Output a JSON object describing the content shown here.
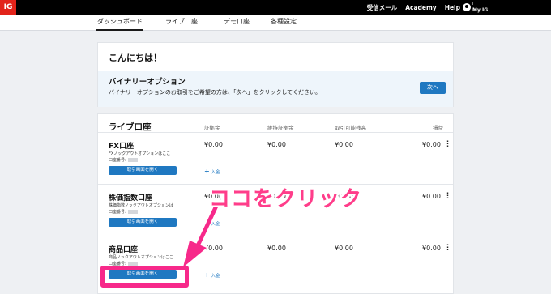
{
  "topbar": {
    "logo": "IG",
    "links": [
      "受信メール",
      "Academy",
      "Help"
    ],
    "user_name": "I",
    "user_sub": "My IG"
  },
  "nav": {
    "items": [
      "ダッシュボード",
      "ライブ口座",
      "デモ口座",
      "各種設定"
    ],
    "active_index": 0
  },
  "greeting": {
    "title": "こんにちは！",
    "binary_title": "バイナリーオプション",
    "binary_desc": "バイナリーオプションのお取引をご希望の方は、「次へ」をクリックしてください。",
    "next_button": "次へ"
  },
  "live": {
    "title": "ライブ口座",
    "columns": [
      "証拠金",
      "維持証拠金",
      "取引可能残高",
      "損益"
    ],
    "rows": [
      {
        "name": "FX口座",
        "sub": "FXノックアウトオプションはここ",
        "account_label": "口座番号:",
        "margin": "¥0.00",
        "maint": "¥0.00",
        "available": "¥0.00",
        "pl": "¥0.00",
        "open_button": "取引画面を開く",
        "deposit": "入金"
      },
      {
        "name": "株価指数口座",
        "sub": "株価指数ノックアウトオプションはここ",
        "account_label": "口座番号:",
        "margin": "¥0.0(",
        "maint": "¥0.00",
        "available": "¥0.00",
        "pl": "¥0.00",
        "open_button": "取引画面を開く",
        "deposit": "入金"
      },
      {
        "name": "商品口座",
        "sub": "商品ノックアウトオプションはここ",
        "account_label": "口座番号:",
        "margin": "¥0.00",
        "maint": "¥0.00",
        "available": "¥0.00",
        "pl": "¥0.00",
        "open_button": "取引画面を開く",
        "deposit": "入金"
      }
    ]
  },
  "annotation": {
    "callout": "ココをクリック",
    "color": "#f7298a"
  },
  "colors": {
    "brand_red": "#e2231a",
    "button_blue": "#1f78c1",
    "topbar": "#000000"
  }
}
